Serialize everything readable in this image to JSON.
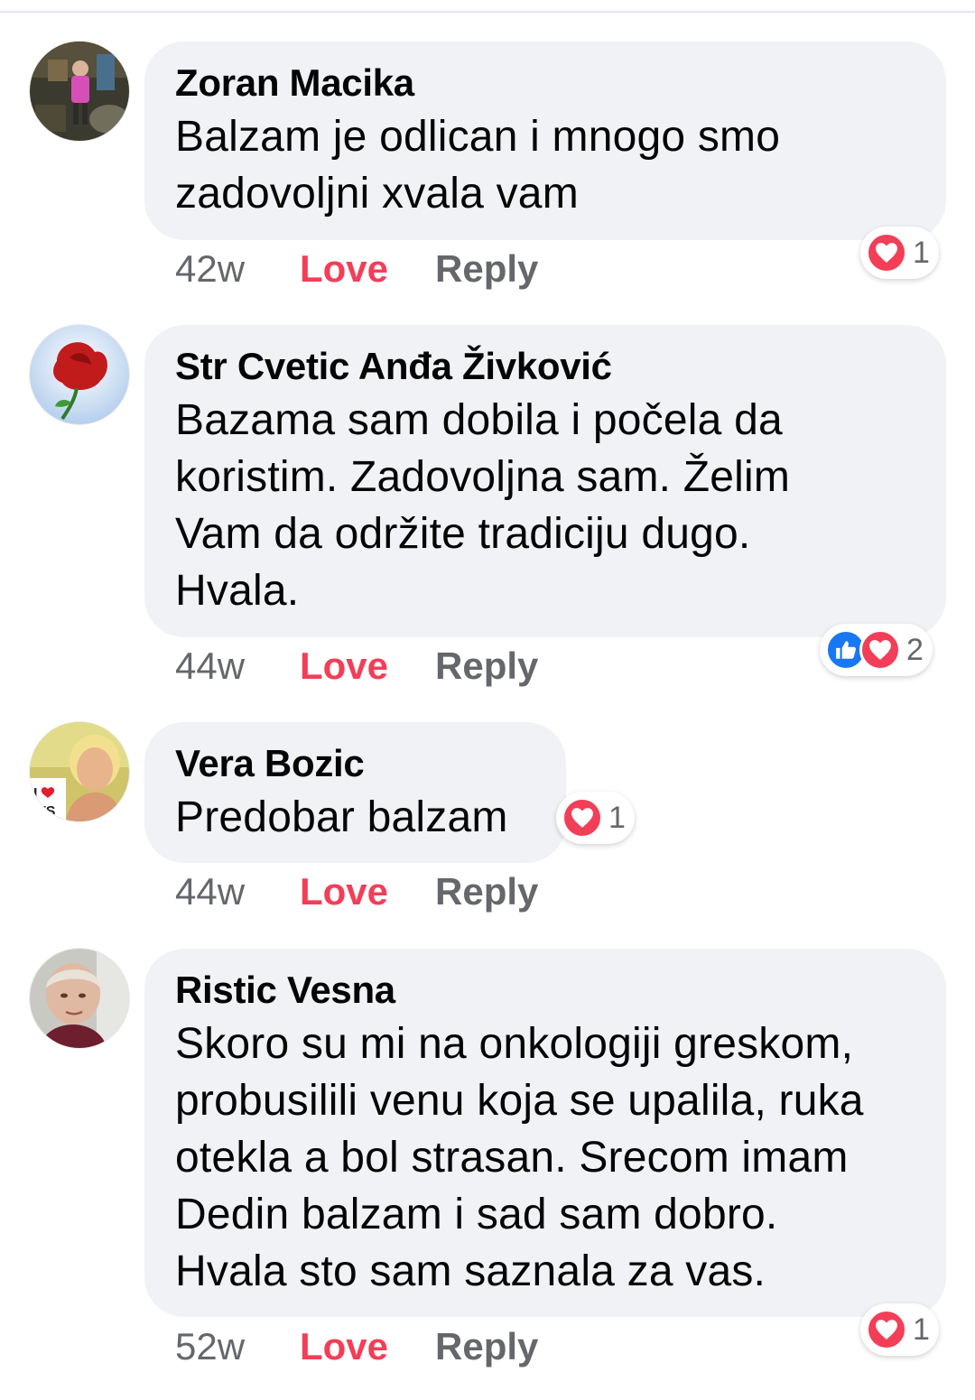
{
  "comments": [
    {
      "author": "Zoran Macika",
      "text": "Balzam je odlican i mnogo smo\nzadovoljni xvala vam",
      "time": "42w",
      "love_label": "Love",
      "reply_label": "Reply",
      "reaction_count": "1"
    },
    {
      "author": "Str Cvetic Anđa Živković",
      "text": "Bazama sam dobila i počela da\nkoristim. Zadovoljna sam. Želim\nVam da održite tradiciju dugo.\nHvala.",
      "time": "44w",
      "love_label": "Love",
      "reply_label": "Reply",
      "reaction_count": "2"
    },
    {
      "author": "Vera Bozic",
      "text": "Predobar balzam",
      "time": "44w",
      "love_label": "Love",
      "reply_label": "Reply",
      "reaction_count": "1"
    },
    {
      "author": "Ristic Vesna",
      "text": "Skoro su mi na onkologiji greskom,\nprobusilili venu koja se upalila, ruka\notekla a bol strasan. Srecom imam\nDedin balzam i sad sam dobro.\nHvala sto sam saznala za vas.",
      "time": "52w",
      "love_label": "Love",
      "reply_label": "Reply",
      "reaction_count": "1"
    }
  ],
  "colors": {
    "love": "#f33e58",
    "like": "#1877f2",
    "muted": "#65676b",
    "bubble": "#f0f2f5"
  },
  "icons": {
    "heart": "heart-reaction-icon",
    "like": "like-reaction-icon"
  }
}
